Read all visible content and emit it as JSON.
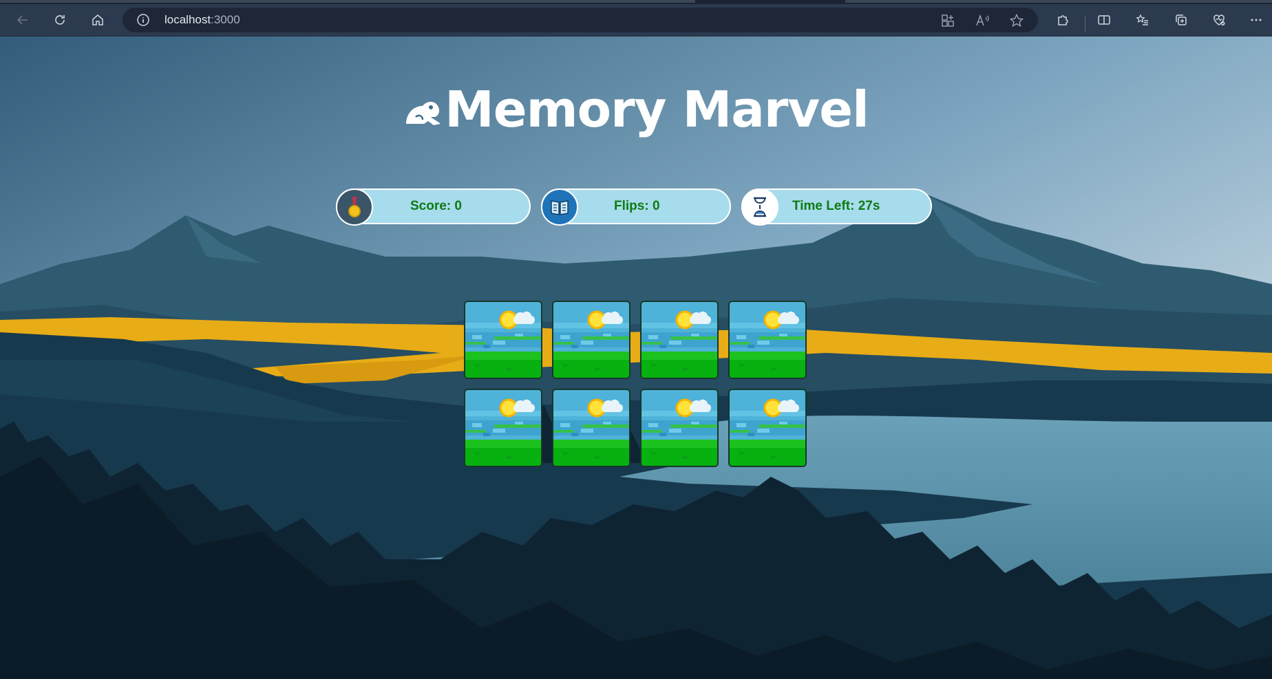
{
  "browser": {
    "url_host": "localhost",
    "url_port": ":3000"
  },
  "game": {
    "title": "Memory Marvel",
    "stats": {
      "score_label": "Score: 0",
      "flips_label": "Flips: 0",
      "time_label": "Time Left: 27s"
    },
    "grid": {
      "rows": 2,
      "cols": 4,
      "face_down": 8
    }
  },
  "icons": {
    "back": "back-arrow-icon",
    "refresh": "refresh-icon",
    "home": "home-icon",
    "site_info": "info-icon",
    "score": "medal-icon",
    "flips": "book-icon",
    "time": "hourglass-icon"
  },
  "colors": {
    "stat_text": "#0f7a12",
    "stat_bg": "#a7dcec",
    "title": "#ffffff"
  }
}
